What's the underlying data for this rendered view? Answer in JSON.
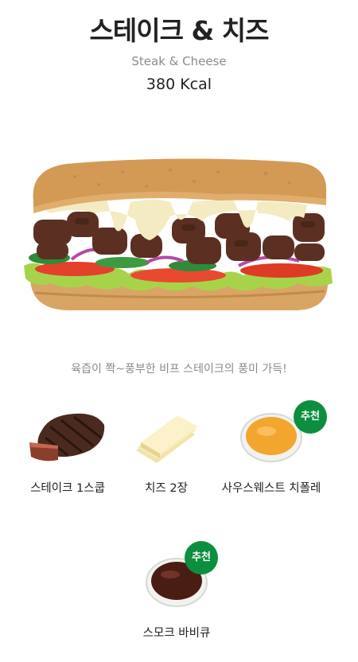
{
  "product": {
    "name_ko": "스테이크 & 치즈",
    "name_en": "Steak & Cheese",
    "calories": "380 Kcal",
    "description": "육즙이 쫙~풍부한 비프 스테이크의 풍미 가득!"
  },
  "ingredients": [
    {
      "label": "스테이크 1스쿱",
      "icon": "steak-icon",
      "badge": ""
    },
    {
      "label": "치즈 2장",
      "icon": "cheese-slices-icon",
      "badge": ""
    },
    {
      "label": "사우스웨스트 치폴레",
      "icon": "chipotle-sauce-icon",
      "badge": "추천"
    },
    {
      "label": "스모크 바비큐",
      "icon": "bbq-sauce-icon",
      "badge": "추천"
    }
  ],
  "colors": {
    "badge_green": "#0b8f3e",
    "title": "#222222",
    "muted": "#8c8c8c"
  }
}
